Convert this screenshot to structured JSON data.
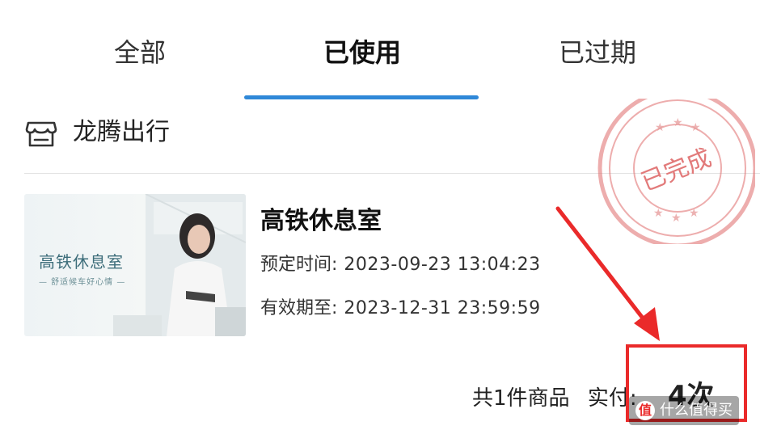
{
  "tabs": [
    {
      "label": "全部",
      "active": false
    },
    {
      "label": "已使用",
      "active": true
    },
    {
      "label": "已过期",
      "active": false
    }
  ],
  "accent_color": "#2f88d8",
  "order": {
    "shop_name": "龙腾出行",
    "shop_icon": "store-icon",
    "stamp_text": "已完成",
    "thumbnail": {
      "title": "高铁休息室",
      "subtitle": "— 舒适候车好心情 —"
    },
    "product_title": "高铁休息室",
    "booking_label": "预定时间:",
    "booking_value": "2023-09-23 13:04:23",
    "expiry_label": "有效期至:",
    "expiry_value": "2023-12-31 23:59:59",
    "summary_count": "共1件商品",
    "summary_paid_label": "实付:",
    "summary_paid_value": "4次"
  },
  "annotation_color": "#ea2a2a",
  "watermark": {
    "badge": "值",
    "text": "什么值得买"
  }
}
